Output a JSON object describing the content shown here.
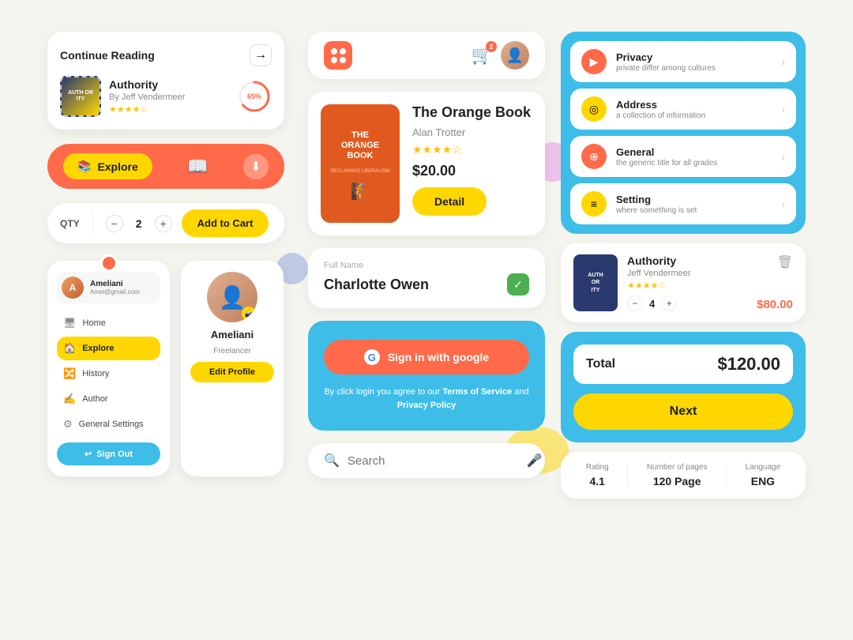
{
  "continueReading": {
    "title": "Continue Reading",
    "arrowLabel": "→",
    "book": {
      "name": "Authority",
      "author": "By Jeff Vendermeer",
      "stars": "★★★★☆",
      "progress": 65,
      "coverText": "AUTH\nOR\nITY"
    }
  },
  "exploreBar": {
    "exploreLabel": "Explore",
    "downloadIcon": "⬇"
  },
  "qty": {
    "label": "QTY",
    "value": "2",
    "addToCartLabel": "Add to Cart"
  },
  "sidebar": {
    "userName": "Ameliani",
    "userEmail": "Amel@gmail.com",
    "navItems": [
      {
        "icon": "🖥",
        "label": "Home",
        "active": false
      },
      {
        "icon": "🏠",
        "label": "Explore",
        "active": true
      },
      {
        "icon": "🔀",
        "label": "History",
        "active": false
      },
      {
        "icon": "✍",
        "label": "Author",
        "active": false
      },
      {
        "icon": "⚙",
        "label": "General Settings",
        "active": false
      }
    ],
    "signOutLabel": "Sign Out"
  },
  "profileCard": {
    "name": "Ameliani",
    "role": "Freelancer",
    "editLabel": "Edit Profile"
  },
  "appHeader": {
    "cartCount": "2"
  },
  "bookDetail": {
    "title": "The Orange Book",
    "author": "Alan Trotter",
    "stars": "★★★★☆",
    "price": "$20.00",
    "detailLabel": "Detail",
    "coverLines": [
      "THE",
      "ORANGE",
      "BOOK",
      "RECLAIMING LIBERALISM"
    ]
  },
  "formCard": {
    "fieldLabel": "Full Name",
    "fieldValue": "Charlotte Owen"
  },
  "signIn": {
    "googleLabel": "Sign in with google",
    "termsText": "By click login you agree to our ",
    "termsLink1": "Terms\nof Service",
    "termsAnd": " and ",
    "termsLink2": "Privacy Policy"
  },
  "searchBar": {
    "placeholder": "Search"
  },
  "settings": {
    "items": [
      {
        "icon": "▶",
        "iconBg": "#ff6b4a",
        "title": "Privacy",
        "sub": "private differ among cultures"
      },
      {
        "icon": "◎",
        "iconBg": "#ffd700",
        "title": "Address",
        "sub": "a collection of information"
      },
      {
        "icon": "⊕",
        "iconBg": "#ff6b4a",
        "title": "General",
        "sub": "the generic title for all grades"
      },
      {
        "icon": "≡",
        "iconBg": "#ffd700",
        "title": "Setting",
        "sub": "where something is set"
      }
    ]
  },
  "cartItem": {
    "bookName": "Authority",
    "bookAuthor": "Jeff Vendermeer",
    "stars": "★★★★☆",
    "qty": "4",
    "price": "$80.00",
    "coverText": "AUTH\nOR\nITY"
  },
  "totalCard": {
    "totalLabel": "Total",
    "totalAmount": "$120.00",
    "nextLabel": "Next"
  },
  "bookStats": {
    "rating": {
      "label": "Rating",
      "value": "4.1"
    },
    "pages": {
      "label": "Number of pages",
      "value": "120 Page"
    },
    "language": {
      "label": "Language",
      "value": "ENG"
    }
  }
}
